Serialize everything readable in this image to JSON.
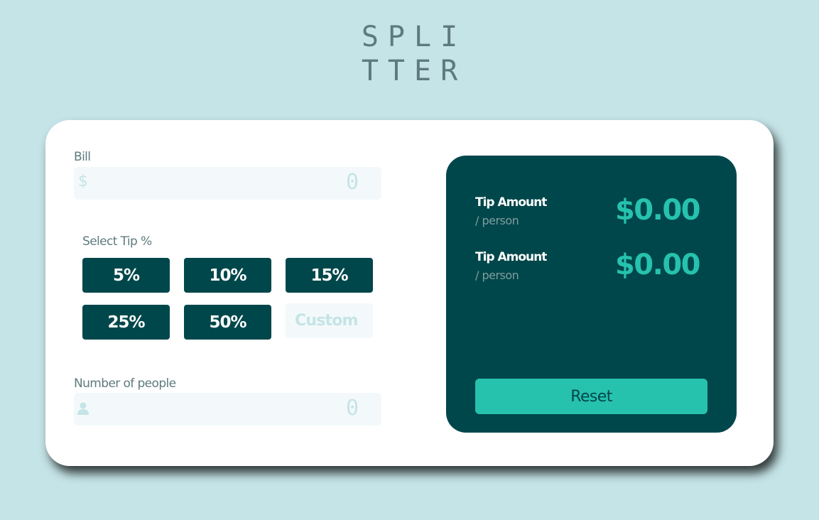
{
  "logo": {
    "line1": "SPLI",
    "line2": "TTER"
  },
  "bill": {
    "label": "Bill",
    "prefix": "$",
    "value": "0"
  },
  "tip": {
    "label": "Select Tip %",
    "options": [
      "5%",
      "10%",
      "15%",
      "25%",
      "50%"
    ],
    "custom_placeholder": "Custom"
  },
  "people": {
    "label": "Number of people",
    "value": "0",
    "icon": "person-icon"
  },
  "results": {
    "rows": [
      {
        "title": "Tip Amount",
        "sub": "/ person",
        "amount": "$0.00"
      },
      {
        "title": "Tip Amount",
        "sub": "/ person",
        "amount": "$0.00"
      }
    ],
    "reset_label": "Reset"
  },
  "colors": {
    "background": "#c5e4e7",
    "dark_cyan": "#00474b",
    "accent": "#26c2ae",
    "input_bg": "#f3f9fa",
    "label_text": "#5e7a7d"
  }
}
